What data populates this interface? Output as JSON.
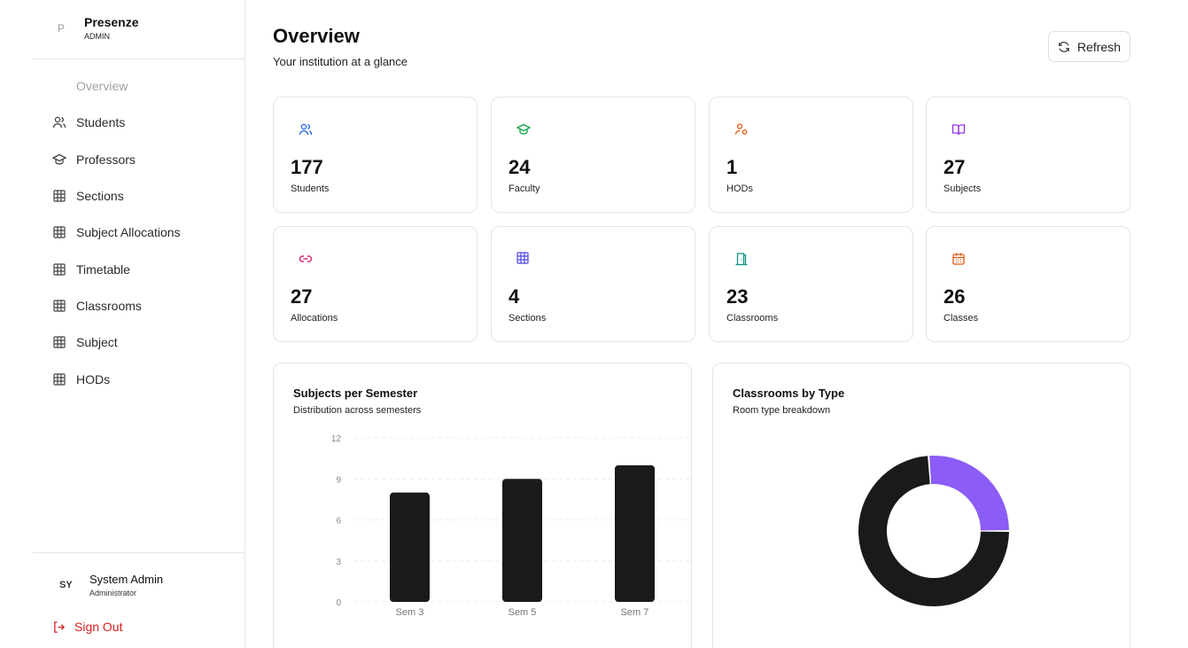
{
  "brand": {
    "logo": "P",
    "name": "Presenze",
    "role": "ADMIN"
  },
  "nav": [
    {
      "label": "Overview",
      "icon": "none",
      "active": true
    },
    {
      "label": "Students",
      "icon": "users-icon"
    },
    {
      "label": "Professors",
      "icon": "graduation-cap-icon"
    },
    {
      "label": "Sections",
      "icon": "grid-icon"
    },
    {
      "label": "Subject Allocations",
      "icon": "grid-icon"
    },
    {
      "label": "Timetable",
      "icon": "grid-icon"
    },
    {
      "label": "Classrooms",
      "icon": "grid-icon"
    },
    {
      "label": "Subject",
      "icon": "grid-icon"
    },
    {
      "label": "HODs",
      "icon": "grid-icon"
    }
  ],
  "user": {
    "initials": "SY",
    "name": "System Admin",
    "role": "Administrator",
    "signout": "Sign Out"
  },
  "header": {
    "title": "Overview",
    "subtitle": "Your institution at a glance",
    "refresh": "Refresh"
  },
  "stats": [
    {
      "value": "177",
      "label": "Students",
      "icon": "users-icon",
      "color": "#2563eb"
    },
    {
      "value": "24",
      "label": "Faculty",
      "icon": "graduation-cap-icon",
      "color": "#16a34a"
    },
    {
      "value": "1",
      "label": "HODs",
      "icon": "user-cog-icon",
      "color": "#ea580c"
    },
    {
      "value": "27",
      "label": "Subjects",
      "icon": "book-open-icon",
      "color": "#9333ea"
    },
    {
      "value": "27",
      "label": "Allocations",
      "icon": "link-icon",
      "color": "#db2777"
    },
    {
      "value": "4",
      "label": "Sections",
      "icon": "grid-icon",
      "color": "#4f46e5"
    },
    {
      "value": "23",
      "label": "Classrooms",
      "icon": "door-icon",
      "color": "#0d9488"
    },
    {
      "value": "26",
      "label": "Classes",
      "icon": "calendar-icon",
      "color": "#ea580c"
    }
  ],
  "panels": {
    "semester": {
      "title": "Subjects per Semester",
      "subtitle": "Distribution across semesters"
    },
    "classrooms": {
      "title": "Classrooms by Type",
      "subtitle": "Room type breakdown"
    }
  },
  "chart_data": [
    {
      "type": "bar",
      "title": "Subjects per Semester",
      "categories": [
        "Sem 3",
        "Sem 5",
        "Sem 7"
      ],
      "values": [
        8,
        9,
        10
      ],
      "ylim": [
        0,
        12
      ],
      "yticks": [
        0,
        3,
        6,
        9,
        12
      ],
      "grid": true,
      "bar_color": "#1a1a1a"
    },
    {
      "type": "pie",
      "title": "Classrooms by Type",
      "donut": true,
      "values": [
        17,
        6
      ],
      "colors": [
        "#1a1a1a",
        "#8b5cf6"
      ]
    }
  ]
}
